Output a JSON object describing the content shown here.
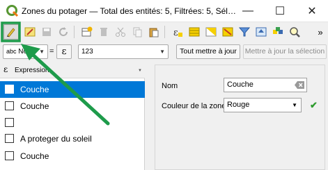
{
  "window": {
    "title": "Zones du potager — Total des entités: 5, Filtrées: 5, Sél…",
    "minimize": "—",
    "maximize": "☐",
    "close": "✕"
  },
  "toolbar": {
    "icons": [
      "pencil-icon",
      "multi-edit-icon",
      "save-icon",
      "reload-icon",
      "add-feature-icon",
      "delete-icon",
      "cut-icon",
      "copy-icon",
      "paste-icon",
      "expression-select-icon",
      "select-all-icon",
      "invert-selection-icon",
      "deselect-icon",
      "filter-icon",
      "move-top-icon",
      "pan-icon",
      "zoom-icon",
      "more-icon"
    ]
  },
  "field_calc": {
    "field_type": "abc",
    "field_name": "Nom",
    "equals": "=",
    "epsilon": "ε",
    "value": "123",
    "update_all": "Tout mettre à jour",
    "update_selection": "Mettre à jour la sélection",
    "overflow": "»"
  },
  "list": {
    "header_symbol": "ε",
    "header_label": "Expression",
    "rows": [
      {
        "label": "Couche",
        "selected": true
      },
      {
        "label": "Couche",
        "selected": false
      },
      {
        "label": "",
        "selected": false
      },
      {
        "label": "A proteger du soleil",
        "selected": false
      },
      {
        "label": "Couche",
        "selected": false
      }
    ]
  },
  "form": {
    "nom_label": "Nom",
    "nom_value": "Couche",
    "couleur_label": "Couleur de la zone",
    "couleur_value": "Rouge"
  },
  "colors": {
    "accent": "#0078d7",
    "annotation": "#1e9b4b"
  }
}
